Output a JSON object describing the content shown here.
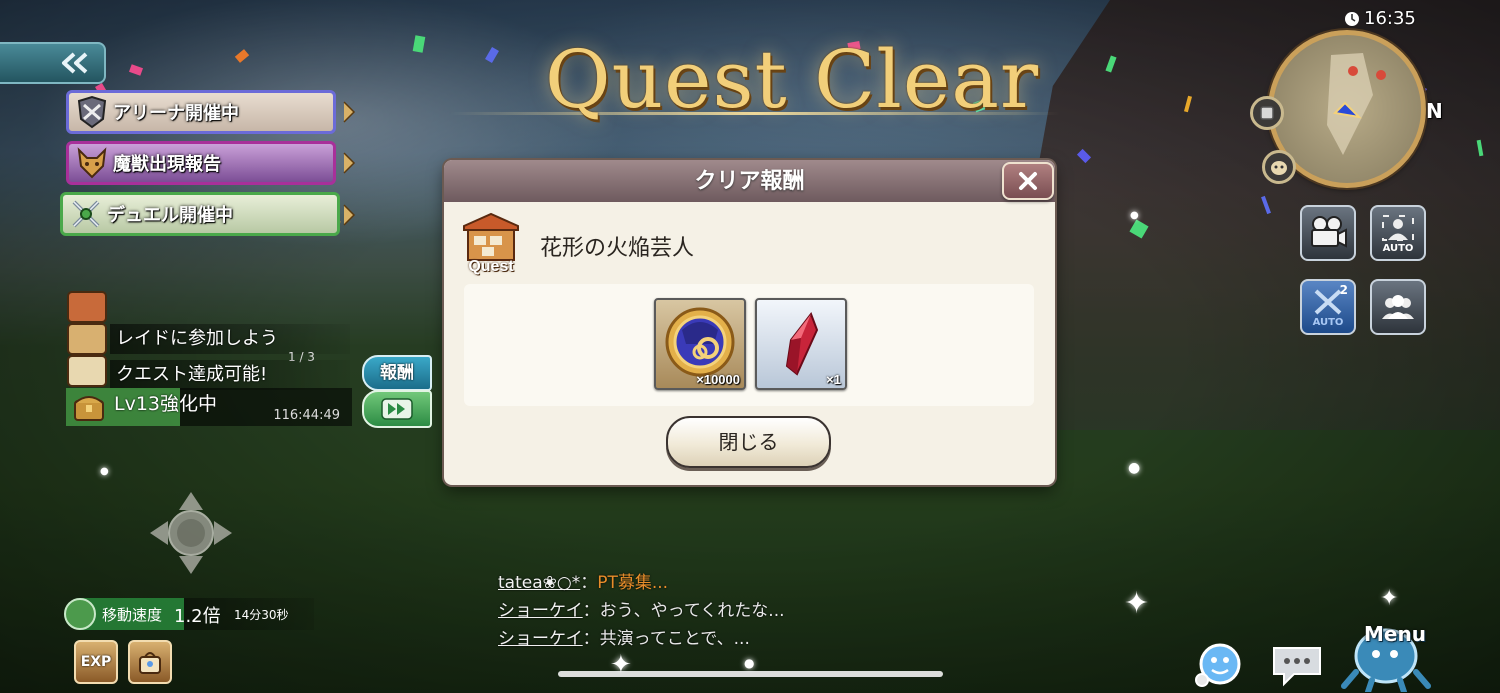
{
  "title": "Quest Clear",
  "dialog": {
    "header": "クリア報酬",
    "quest_icon_label": "Quest",
    "quest_name": "花形の火焔芸人",
    "rewards": [
      {
        "icon": "gold-coin-icon",
        "qty": "×10000"
      },
      {
        "icon": "red-crystal-icon",
        "qty": "×1"
      }
    ],
    "close_button_label": "閉じる"
  },
  "left_hud": {
    "banners": [
      {
        "label": "アリーナ開催中",
        "icon": "arena-icon"
      },
      {
        "label": "魔獣出現報告",
        "icon": "beast-icon"
      },
      {
        "label": "デュエル開催中",
        "icon": "duel-icon"
      }
    ],
    "missions": [
      {
        "label": "レイドに参加しよう",
        "progress": "1 / 3"
      },
      {
        "label": "クエスト達成可能!"
      }
    ],
    "enhance": {
      "label": "Lv13強化中",
      "timer": "116:44:49",
      "progress": 0.4
    },
    "reward_button_label": "報酬",
    "speed_buff": {
      "label": "移動速度",
      "value": "1.2倍",
      "time": "14分30秒"
    },
    "exp_button_label": "EXP"
  },
  "chat": [
    {
      "name": "tatea❀○*",
      "message": "PT募集...",
      "highlight": true
    },
    {
      "name": "ショーケイ",
      "message": "おう、やってくれたな..."
    },
    {
      "name": "ショーケイ",
      "message": "共演ってことで、..."
    }
  ],
  "right_hud": {
    "clock": "16:35",
    "north": "N",
    "auto_label": "AUTO",
    "auto_speed_label": "AUTO",
    "auto_speed_multiplier": "2",
    "menu_label": "Menu"
  }
}
